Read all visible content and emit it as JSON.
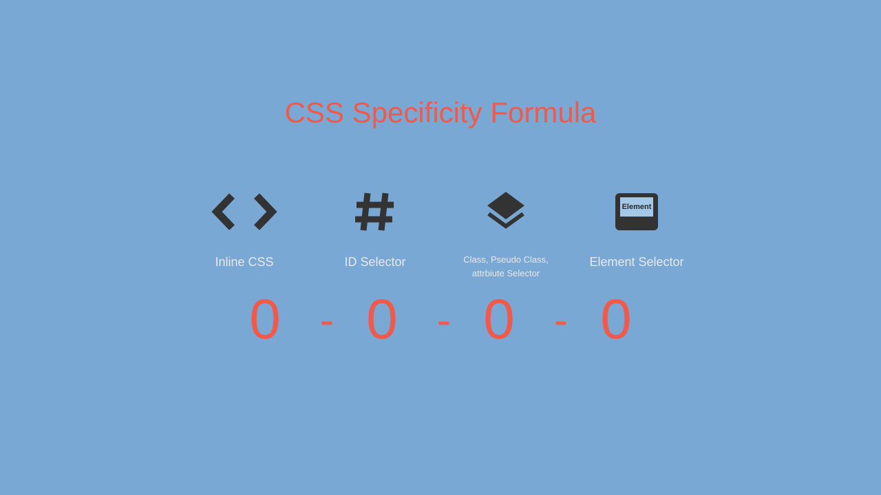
{
  "title": "CSS Specificity Formula",
  "columns": [
    {
      "label": "Inline CSS",
      "icon": "angle-brackets",
      "value": "0"
    },
    {
      "label": "ID Selector",
      "icon": "hash",
      "value": "0"
    },
    {
      "label_line1": "Class, Pseudo Class,",
      "label_line2": "attrbiute Selector",
      "icon": "layers",
      "value": "0"
    },
    {
      "label": "Element Selector",
      "icon": "element-box",
      "icon_text": "Element",
      "value": "0"
    }
  ],
  "separator": "-",
  "colors": {
    "background": "#7aa8d4",
    "accent": "#f15a4a",
    "icon": "#333333",
    "label": "#e8e8e8"
  }
}
